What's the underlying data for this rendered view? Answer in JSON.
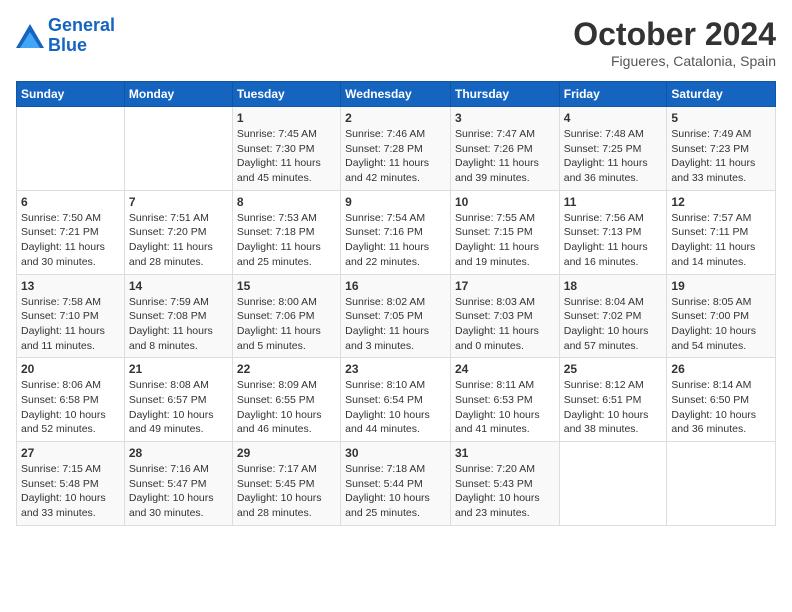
{
  "logo": {
    "line1": "General",
    "line2": "Blue"
  },
  "title": "October 2024",
  "location": "Figueres, Catalonia, Spain",
  "headers": [
    "Sunday",
    "Monday",
    "Tuesday",
    "Wednesday",
    "Thursday",
    "Friday",
    "Saturday"
  ],
  "weeks": [
    [
      {
        "day": "",
        "info": ""
      },
      {
        "day": "",
        "info": ""
      },
      {
        "day": "1",
        "info": "Sunrise: 7:45 AM\nSunset: 7:30 PM\nDaylight: 11 hours and 45 minutes."
      },
      {
        "day": "2",
        "info": "Sunrise: 7:46 AM\nSunset: 7:28 PM\nDaylight: 11 hours and 42 minutes."
      },
      {
        "day": "3",
        "info": "Sunrise: 7:47 AM\nSunset: 7:26 PM\nDaylight: 11 hours and 39 minutes."
      },
      {
        "day": "4",
        "info": "Sunrise: 7:48 AM\nSunset: 7:25 PM\nDaylight: 11 hours and 36 minutes."
      },
      {
        "day": "5",
        "info": "Sunrise: 7:49 AM\nSunset: 7:23 PM\nDaylight: 11 hours and 33 minutes."
      }
    ],
    [
      {
        "day": "6",
        "info": "Sunrise: 7:50 AM\nSunset: 7:21 PM\nDaylight: 11 hours and 30 minutes."
      },
      {
        "day": "7",
        "info": "Sunrise: 7:51 AM\nSunset: 7:20 PM\nDaylight: 11 hours and 28 minutes."
      },
      {
        "day": "8",
        "info": "Sunrise: 7:53 AM\nSunset: 7:18 PM\nDaylight: 11 hours and 25 minutes."
      },
      {
        "day": "9",
        "info": "Sunrise: 7:54 AM\nSunset: 7:16 PM\nDaylight: 11 hours and 22 minutes."
      },
      {
        "day": "10",
        "info": "Sunrise: 7:55 AM\nSunset: 7:15 PM\nDaylight: 11 hours and 19 minutes."
      },
      {
        "day": "11",
        "info": "Sunrise: 7:56 AM\nSunset: 7:13 PM\nDaylight: 11 hours and 16 minutes."
      },
      {
        "day": "12",
        "info": "Sunrise: 7:57 AM\nSunset: 7:11 PM\nDaylight: 11 hours and 14 minutes."
      }
    ],
    [
      {
        "day": "13",
        "info": "Sunrise: 7:58 AM\nSunset: 7:10 PM\nDaylight: 11 hours and 11 minutes."
      },
      {
        "day": "14",
        "info": "Sunrise: 7:59 AM\nSunset: 7:08 PM\nDaylight: 11 hours and 8 minutes."
      },
      {
        "day": "15",
        "info": "Sunrise: 8:00 AM\nSunset: 7:06 PM\nDaylight: 11 hours and 5 minutes."
      },
      {
        "day": "16",
        "info": "Sunrise: 8:02 AM\nSunset: 7:05 PM\nDaylight: 11 hours and 3 minutes."
      },
      {
        "day": "17",
        "info": "Sunrise: 8:03 AM\nSunset: 7:03 PM\nDaylight: 11 hours and 0 minutes."
      },
      {
        "day": "18",
        "info": "Sunrise: 8:04 AM\nSunset: 7:02 PM\nDaylight: 10 hours and 57 minutes."
      },
      {
        "day": "19",
        "info": "Sunrise: 8:05 AM\nSunset: 7:00 PM\nDaylight: 10 hours and 54 minutes."
      }
    ],
    [
      {
        "day": "20",
        "info": "Sunrise: 8:06 AM\nSunset: 6:58 PM\nDaylight: 10 hours and 52 minutes."
      },
      {
        "day": "21",
        "info": "Sunrise: 8:08 AM\nSunset: 6:57 PM\nDaylight: 10 hours and 49 minutes."
      },
      {
        "day": "22",
        "info": "Sunrise: 8:09 AM\nSunset: 6:55 PM\nDaylight: 10 hours and 46 minutes."
      },
      {
        "day": "23",
        "info": "Sunrise: 8:10 AM\nSunset: 6:54 PM\nDaylight: 10 hours and 44 minutes."
      },
      {
        "day": "24",
        "info": "Sunrise: 8:11 AM\nSunset: 6:53 PM\nDaylight: 10 hours and 41 minutes."
      },
      {
        "day": "25",
        "info": "Sunrise: 8:12 AM\nSunset: 6:51 PM\nDaylight: 10 hours and 38 minutes."
      },
      {
        "day": "26",
        "info": "Sunrise: 8:14 AM\nSunset: 6:50 PM\nDaylight: 10 hours and 36 minutes."
      }
    ],
    [
      {
        "day": "27",
        "info": "Sunrise: 7:15 AM\nSunset: 5:48 PM\nDaylight: 10 hours and 33 minutes."
      },
      {
        "day": "28",
        "info": "Sunrise: 7:16 AM\nSunset: 5:47 PM\nDaylight: 10 hours and 30 minutes."
      },
      {
        "day": "29",
        "info": "Sunrise: 7:17 AM\nSunset: 5:45 PM\nDaylight: 10 hours and 28 minutes."
      },
      {
        "day": "30",
        "info": "Sunrise: 7:18 AM\nSunset: 5:44 PM\nDaylight: 10 hours and 25 minutes."
      },
      {
        "day": "31",
        "info": "Sunrise: 7:20 AM\nSunset: 5:43 PM\nDaylight: 10 hours and 23 minutes."
      },
      {
        "day": "",
        "info": ""
      },
      {
        "day": "",
        "info": ""
      }
    ]
  ]
}
